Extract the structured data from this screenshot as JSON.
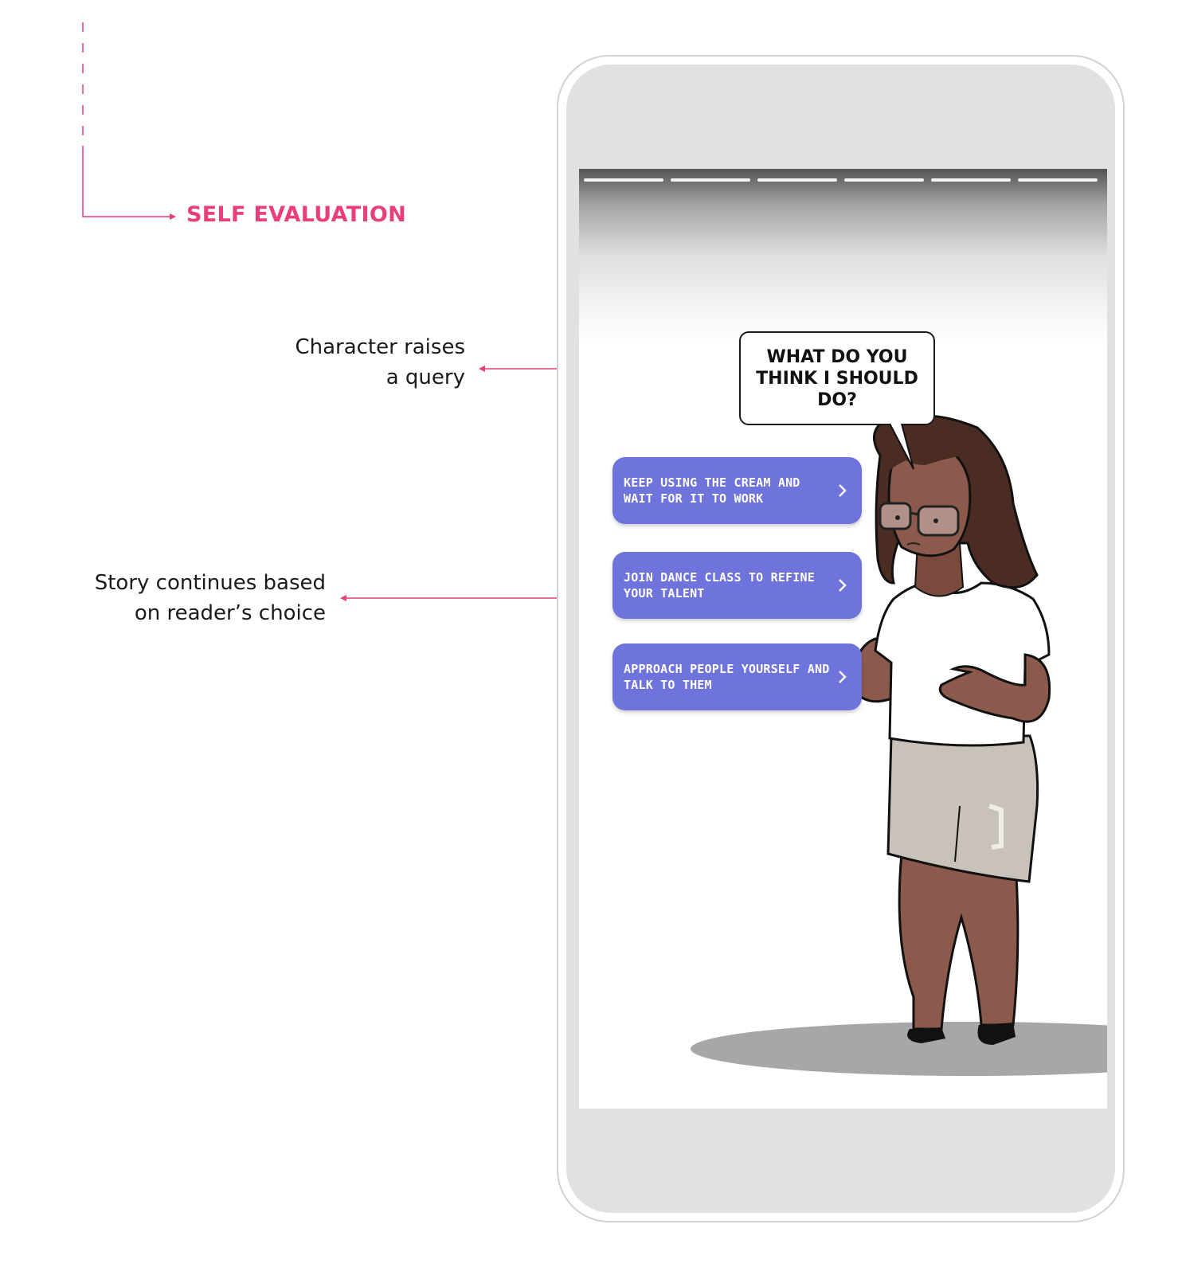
{
  "section_title": "SELF EVALUATION",
  "annotations": {
    "query": [
      "Character raises",
      "a query"
    ],
    "choice": [
      "Story continues based",
      "on reader’s choice"
    ]
  },
  "story": {
    "progress_segments": 6,
    "speech_bubble": "WHAT DO YOU THINK I SHOULD DO?",
    "choices": [
      {
        "label": "KEEP USING THE CREAM AND WAIT FOR IT TO WORK"
      },
      {
        "label": "JOIN DANCE CLASS TO REFINE YOUR TALENT"
      },
      {
        "label": "APPROACH PEOPLE YOURSELF AND TALK TO THEM"
      }
    ]
  },
  "colors": {
    "accent": "#e83e7a",
    "choice_button": "#6f73dc",
    "skin": "#8c5a4c",
    "hair": "#4a2c23"
  }
}
